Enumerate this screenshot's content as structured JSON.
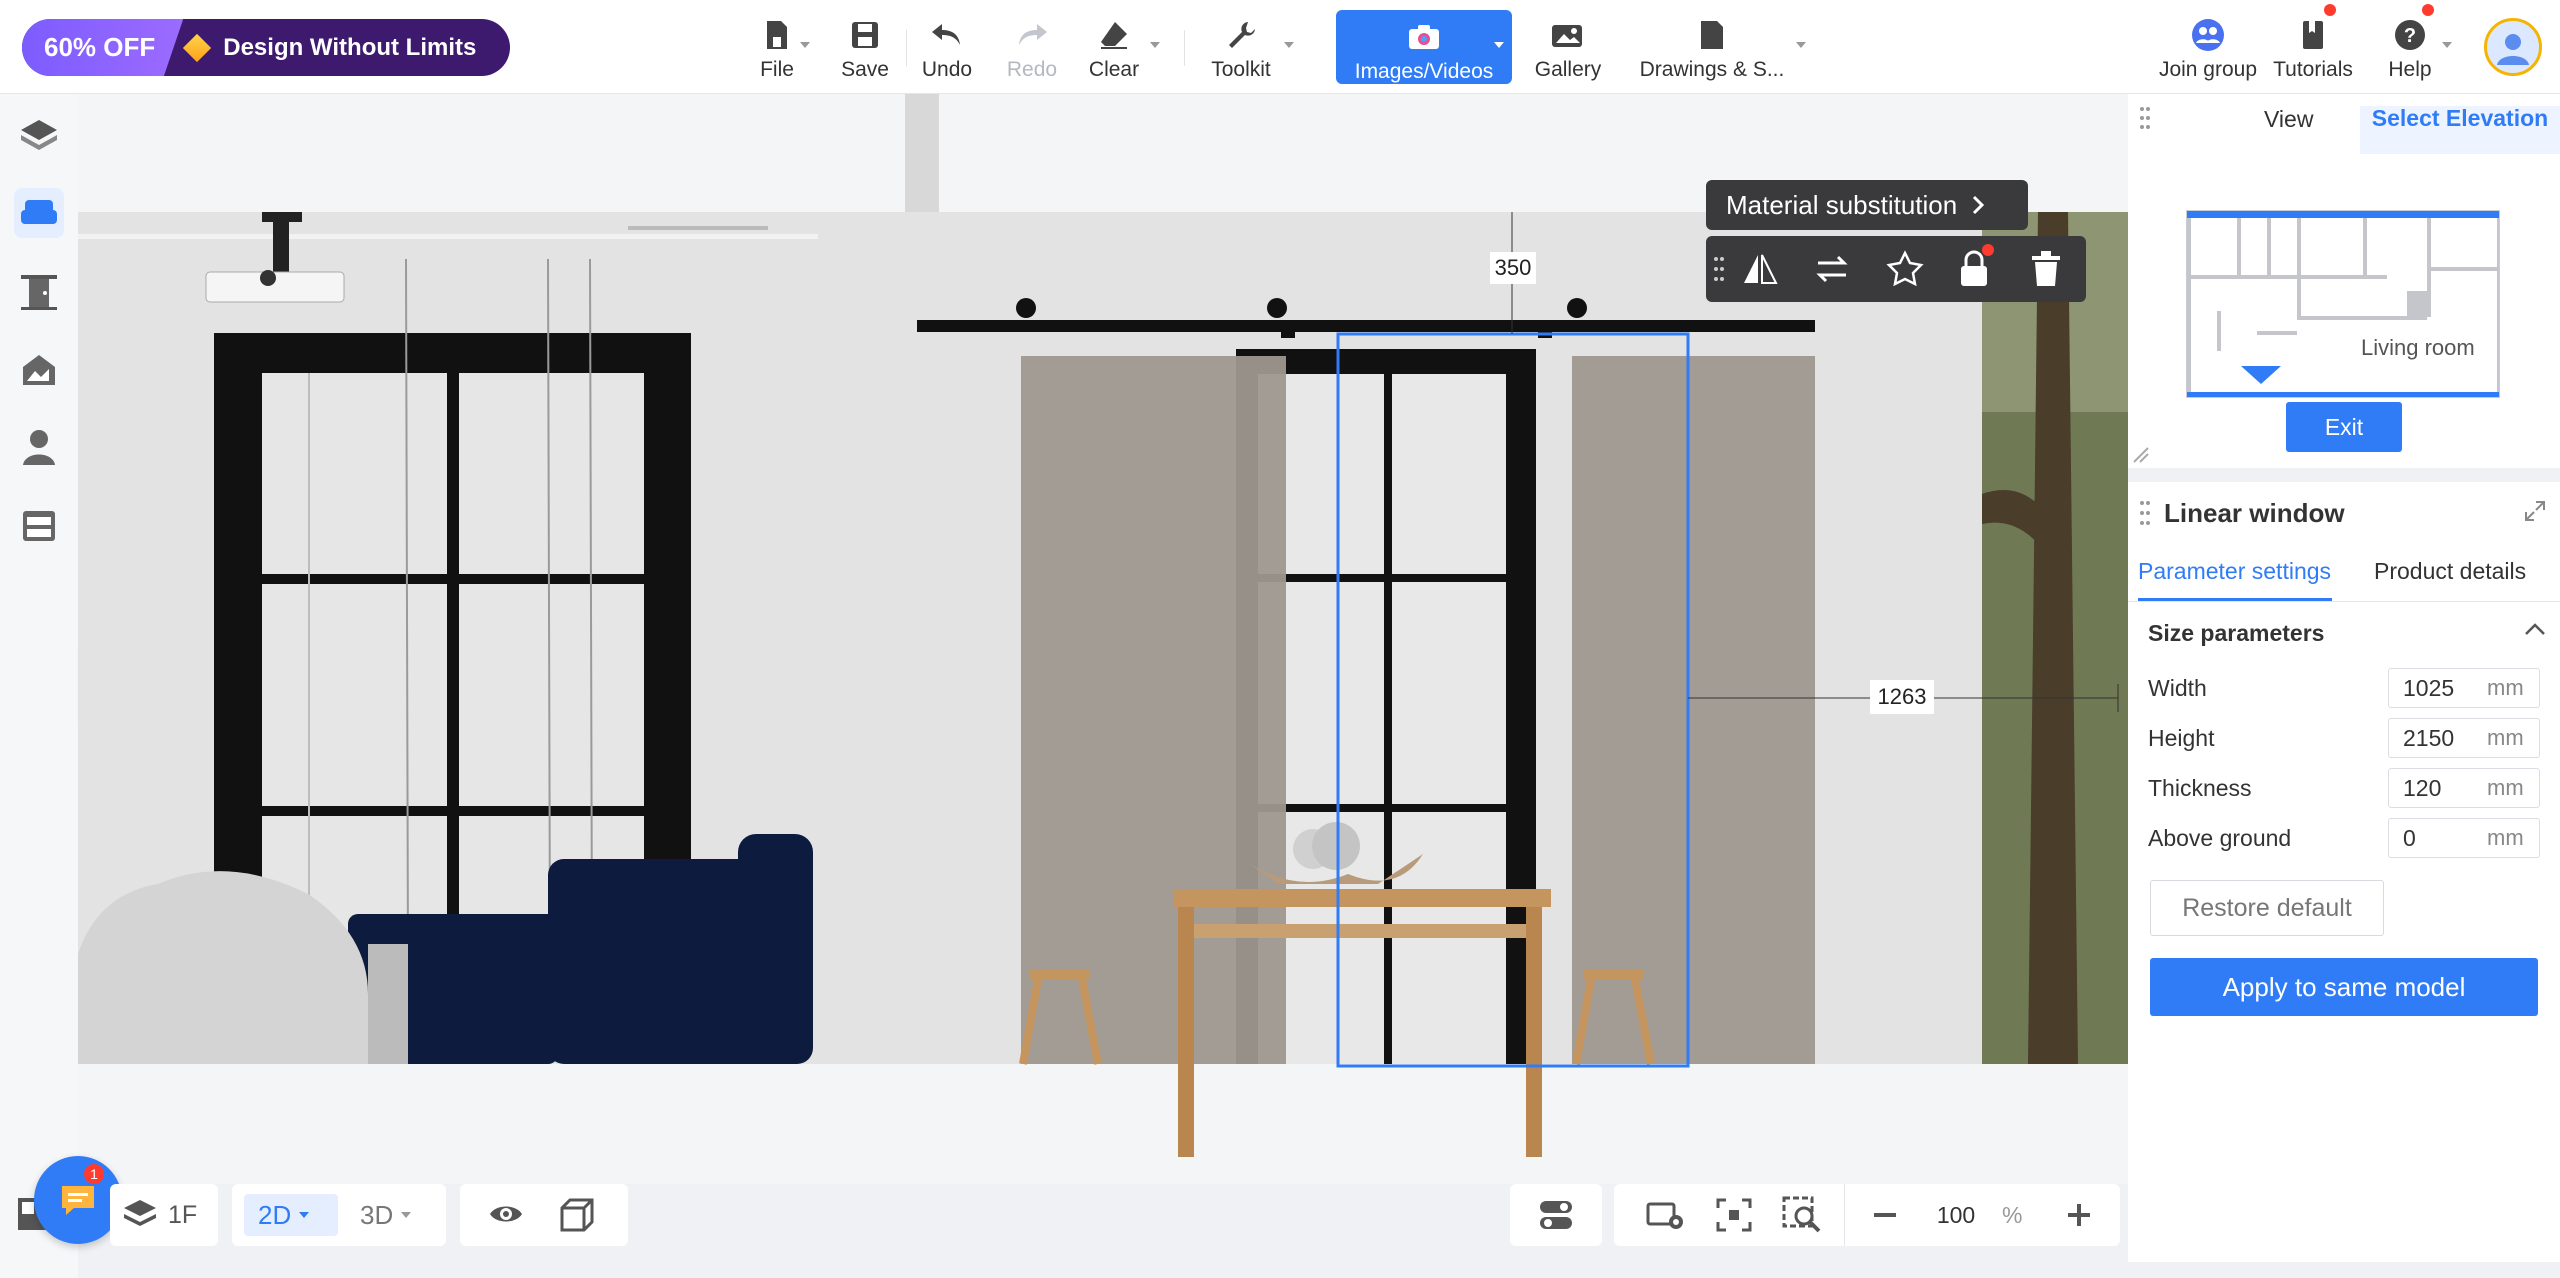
{
  "promo": {
    "discount": "60% OFF",
    "tagline": "Design Without Limits"
  },
  "toolbar": {
    "file": "File",
    "save": "Save",
    "undo": "Undo",
    "redo": "Redo",
    "clear": "Clear",
    "toolkit": "Toolkit",
    "images_videos": "Images/Videos",
    "gallery": "Gallery",
    "drawings": "Drawings & S...",
    "join_group": "Join group",
    "tutorials": "Tutorials",
    "help": "Help"
  },
  "float_toolbar": {
    "material_substitution": "Material substitution"
  },
  "dimensions": {
    "top_offset": "350",
    "side_offset": "1263"
  },
  "elevation_panel": {
    "tab_view": "View",
    "tab_select_elevation": "Select Elevation",
    "room_label": "Living room",
    "exit_button": "Exit"
  },
  "props_panel": {
    "title": "Linear window",
    "tab_params": "Parameter settings",
    "tab_details": "Product details",
    "section_title": "Size parameters",
    "fields": [
      {
        "label": "Width",
        "value": "1025",
        "unit": "mm"
      },
      {
        "label": "Height",
        "value": "2150",
        "unit": "mm"
      },
      {
        "label": "Thickness",
        "value": "120",
        "unit": "mm"
      },
      {
        "label": "Above ground",
        "value": "0",
        "unit": "mm"
      }
    ],
    "restore_default": "Restore default",
    "apply_same_model": "Apply to same model"
  },
  "bottom_bar": {
    "floor": "1F",
    "view_2d": "2D",
    "view_3d": "3D",
    "zoom_value": "100",
    "zoom_unit": "%"
  },
  "chat": {
    "badge_count": "1"
  },
  "colors": {
    "accent": "#2f7cf6",
    "promo_bg": "#3d1a6e",
    "sofa": "#0d1b3e",
    "curtain": "#9f9890"
  }
}
